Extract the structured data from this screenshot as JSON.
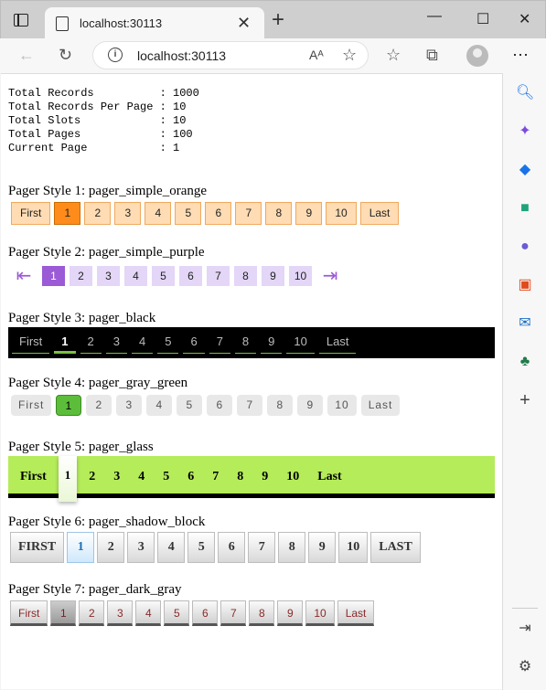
{
  "browser": {
    "tab_title": "localhost:30113",
    "url": "localhost:30113",
    "read_aloud": "Aᴬ"
  },
  "stats": [
    "Total Records          : 1000",
    "Total Records Per Page : 10",
    "Total Slots            : 10",
    "Total Pages            : 100",
    "Current Page           : 1"
  ],
  "pagers": [
    {
      "title": "Pager Style 1: pager_simple_orange",
      "first": "First",
      "last": "Last",
      "pages": [
        "1",
        "2",
        "3",
        "4",
        "5",
        "6",
        "7",
        "8",
        "9",
        "10"
      ]
    },
    {
      "title": "Pager Style 2: pager_simple_purple",
      "pages": [
        "1",
        "2",
        "3",
        "4",
        "5",
        "6",
        "7",
        "8",
        "9",
        "10"
      ]
    },
    {
      "title": "Pager Style 3: pager_black",
      "first": "First",
      "last": "Last",
      "pages": [
        "1",
        "2",
        "3",
        "4",
        "5",
        "6",
        "7",
        "8",
        "9",
        "10"
      ]
    },
    {
      "title": "Pager Style 4: pager_gray_green",
      "first": "First",
      "last": "Last",
      "pages": [
        "1",
        "2",
        "3",
        "4",
        "5",
        "6",
        "7",
        "8",
        "9",
        "10"
      ]
    },
    {
      "title": "Pager Style 5: pager_glass",
      "first": "First",
      "last": "Last",
      "pages": [
        "1",
        "2",
        "3",
        "4",
        "5",
        "6",
        "7",
        "8",
        "9",
        "10"
      ]
    },
    {
      "title": "Pager Style 6: pager_shadow_block",
      "first": "FIRST",
      "last": "LAST",
      "pages": [
        "1",
        "2",
        "3",
        "4",
        "5",
        "6",
        "7",
        "8",
        "9",
        "10"
      ]
    },
    {
      "title": "Pager Style 7: pager_dark_gray",
      "first": "First",
      "last": "Last",
      "pages": [
        "1",
        "2",
        "3",
        "4",
        "5",
        "6",
        "7",
        "8",
        "9",
        "10"
      ]
    }
  ],
  "current_page": 1,
  "colors": {
    "orange": "#ff8c1a",
    "purple": "#9b5ad6",
    "green": "#5cbd3a",
    "lime": "#b5ec5a"
  }
}
